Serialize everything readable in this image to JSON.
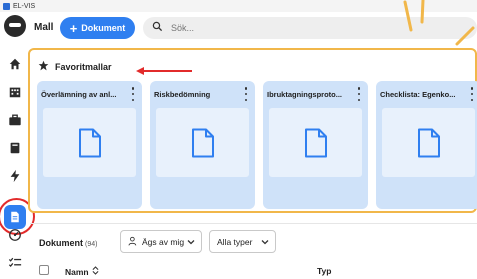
{
  "window": {
    "title": "EL-VIS"
  },
  "header": {
    "title": "Mall",
    "new_button": "Dokument",
    "search_placeholder": "Sök..."
  },
  "favorites": {
    "title": "Favoritmallar",
    "cards": [
      {
        "title": "Överlämning av anl..."
      },
      {
        "title": "Riskbedömning"
      },
      {
        "title": "Ibruktagningsproto..."
      },
      {
        "title": "Checklista: Egenko..."
      }
    ]
  },
  "documents": {
    "label": "Dokument",
    "count": "(94)",
    "filter_owner": "Ägs av mig",
    "filter_types": "Alla typer",
    "columns": {
      "name": "Namn",
      "type": "Typ"
    }
  },
  "colors": {
    "accent": "#2f7ff0",
    "highlight": "#f1b74a",
    "annotation": "#e22b2b",
    "card": "#cfe2f9"
  }
}
